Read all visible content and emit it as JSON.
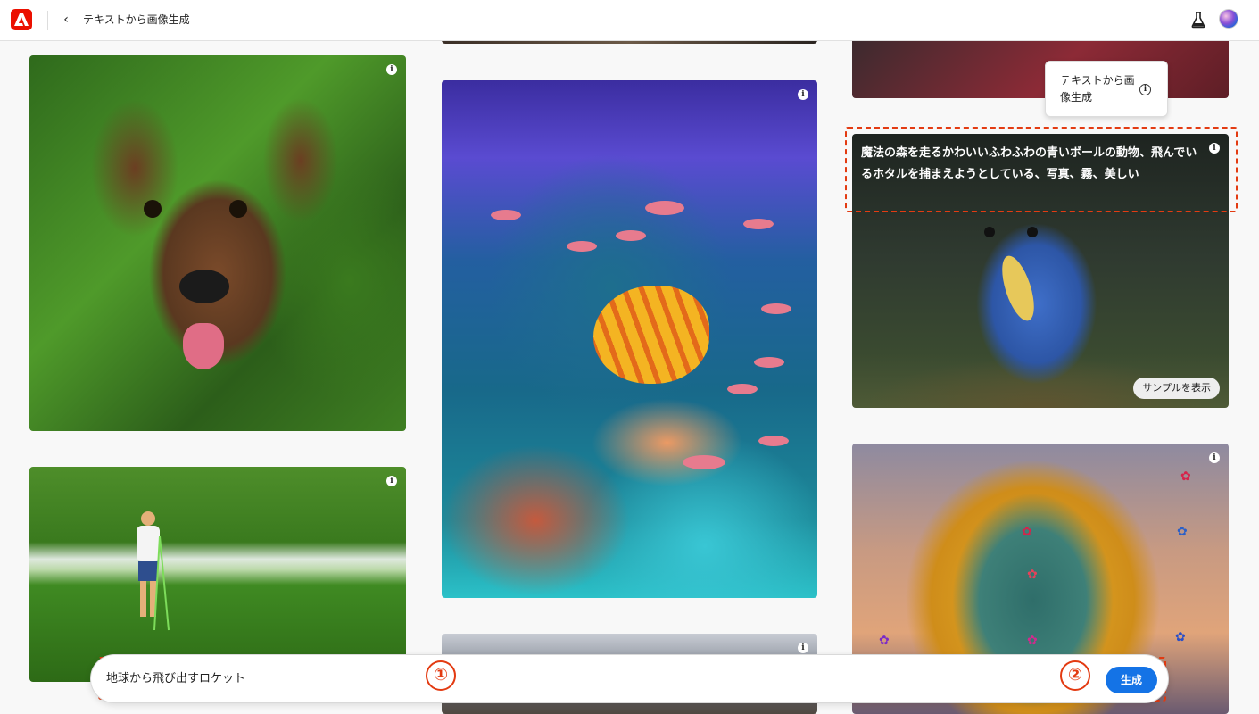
{
  "header": {
    "title": "テキストから画像生成",
    "back_icon": "chevron-left-icon",
    "logo_icon": "adobe-logo-icon",
    "labs_icon": "flask-icon"
  },
  "gallery": {
    "monster_caption": "魔法の森を走るかわいいふわふわの青いボールの動物、飛んでいるホタルを捕まえようとしている、写真、霧、美しい",
    "sample_button": "サンプルを表示",
    "info_icon_glyph": "i"
  },
  "tooltip": {
    "text": "テキストから画像生成",
    "icon_glyph": "i"
  },
  "prompt": {
    "value": "地球から飛び出すロケット",
    "generate_label": "生成"
  },
  "annotations": {
    "marker_1": "①",
    "marker_2": "②",
    "color": "#e33b12"
  },
  "colors": {
    "accent": "#1473e6",
    "brand": "#eb1000"
  }
}
